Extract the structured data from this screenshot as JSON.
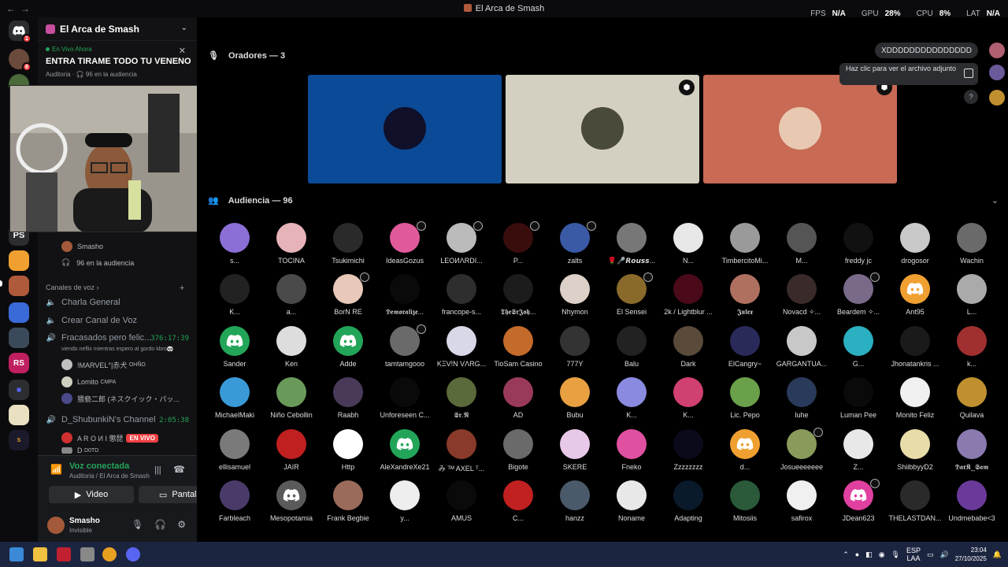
{
  "window": {
    "title": "El Arca de Smash",
    "nav_back": "←",
    "nav_fwd": "→"
  },
  "stats": {
    "fps_label": "FPS",
    "fps": "N/A",
    "gpu_label": "GPU",
    "gpu": "28%",
    "cpu_label": "CPU",
    "cpu": "8%",
    "lat_label": "LAT",
    "lat": "N/A"
  },
  "server": {
    "name": "El Arca de Smash"
  },
  "live_now": {
    "label": "En Vivo Ahora",
    "stage_name": "ENTRA TIRAME TODO TU VENENO",
    "category": "Auditoria",
    "audience": "96 en la audiencia"
  },
  "stage_channel": {
    "user": "Smasho",
    "audience": "96 en la audiencia"
  },
  "voice_section": {
    "label": "Canales de voz",
    "add": "+"
  },
  "channels": [
    {
      "name": "Charla General"
    },
    {
      "name": "Crear Canal de Voz"
    },
    {
      "name": "Fracasados pero felic...",
      "time": "376:17:39",
      "status": "viendo neflix mientras espero al gordo kbro🐼",
      "users": [
        {
          "name": "!MARVEL°|赤犬",
          "tag": "OHÑO"
        },
        {
          "name": "Lomito",
          "tag": "CMPA"
        },
        {
          "name": "猥褻二郎 (ネスクイック・パッ..."
        }
      ]
    },
    {
      "name": "D_ShubunkiN's Channel",
      "time": "2:05:38",
      "users": [
        {
          "name": "A R O И I 懲琵",
          "live": "EN VIVO"
        },
        {
          "name": "D",
          "tag": "D0TD"
        }
      ]
    }
  ],
  "voice_panel": {
    "status": "Voz conectada",
    "location": "Auditoria / El Arca de Smash",
    "video": "Video",
    "screen": "Pantalla"
  },
  "user": {
    "name": "Smasho",
    "status": "Invisible"
  },
  "speakers": {
    "header": "Oradores — 3",
    "tiles": [
      {
        "bg": "#0b4a96",
        "mod": false
      },
      {
        "bg": "#d4d0c1",
        "mod": true
      },
      {
        "bg": "#c86a54",
        "mod": true
      }
    ]
  },
  "audience": {
    "header": "Audiencia — 96"
  },
  "chat": {
    "bubble": "XDDDDDDDDDDDDDDD",
    "attachment": "Haz clic para ver el archivo adjunto",
    "help": "?"
  },
  "members": [
    [
      "s...",
      "TOCINA",
      "Tsukimichi",
      "IdeasGozus",
      "LEOИΛRDI...",
      "P...",
      "zalts",
      "🌹🎤𝙍𝙤𝙪𝙨𝙨...",
      "N...",
      "TimbercitoMi...",
      "M...",
      "freddy jc",
      "drogosor",
      "Wachin"
    ],
    [
      "K...",
      "a...",
      "BorN RE",
      "𝕯𝖊𝖒𝖔𝖗𝖆𝖑𝖎𝖟𝖊...",
      "francope-s...",
      "𝕿𝖍𝖊𝕾𝖗𝕵𝖔𝖍...",
      "Nhymon",
      "El Sensei",
      "2k / Lightblur ...",
      "𝕵𝖚𝖑𝖊𝖝",
      "Novacd ✧...",
      "Beardem ✧...",
      "Ant95",
      "L..."
    ],
    [
      "Sander",
      "Ken",
      "Adde",
      "tamtamgooo",
      "KΞV!N VΛRG...",
      "TioSam Casino",
      "777Y",
      "Balu",
      "Dark",
      "ElCangry~",
      "GARGANTUA...",
      "G...",
      "Jhonatankris ...",
      "k..."
    ],
    [
      "MichaelMaki",
      "Niño Cebollin",
      "Raabh",
      "Unforeseen C...",
      "𝕾𝖗.𝕹",
      "AD",
      "Bubu",
      "K...",
      "K...",
      "Lic. Pepo",
      "luhe",
      "Luman Pee",
      "Monito Feliz",
      "Quilava"
    ],
    [
      "ellisamuel",
      "JAIR",
      "Http",
      "AleXandreXe21",
      "み ᵀᴹ AXEL ᵀ...",
      "Bigote",
      "SKERE",
      "Fneko",
      "Zzzzzzzz",
      "d...",
      "Josueeeeeee",
      "Z...",
      "ShiibbyyD2",
      "𝕯𝖆𝖗𝕶_𝕾𝖆𝖒"
    ],
    [
      "Farbleach",
      "Mesopotamia",
      "Frank Begbie",
      "y...",
      "AMUS",
      "C...",
      "hanzz",
      "Noname",
      "Adapting",
      "Mitosiis",
      "safirox",
      "JDean623",
      "THELASTDAN...",
      "Undmebabe<3"
    ]
  ],
  "avatar_colors": [
    [
      "#8b6fd6",
      "#e6b3b8",
      "#2a2a2a",
      "#e05a9a",
      "#bbbbbb",
      "#3a0d0d",
      "#3a5aa6",
      "#777777",
      "#e8e8e8",
      "#9a9a9a",
      "#555555",
      "#111111",
      "#c9c9c9",
      "#6a6a6a"
    ],
    [
      "#222222",
      "#4a4a4a",
      "#e8c8b8",
      "#0a0a0a",
      "#2e2e2e",
      "#1c1c1c",
      "#ddd0c8",
      "#8a6a2a",
      "#4a0a1a",
      "#b07060",
      "#3a2a2a",
      "#7a6a8a",
      "#f0a030",
      "#aaaaaa"
    ],
    [
      "#23a559",
      "#dddddd",
      "#23a559",
      "#6a6a6a",
      "#d8d8e8",
      "#c46a2a",
      "#333333",
      "#222222",
      "#5a4a3a",
      "#2a2a5a",
      "#c8c8c8",
      "#2ab0c0",
      "#1a1a1a",
      "#a03030"
    ],
    [
      "#3a9ad8",
      "#6a9a5a",
      "#4a3a5a",
      "#0a0a0a",
      "#5a6a3a",
      "#9a3a5a",
      "#e8a040",
      "#8a8ae0",
      "#d04070",
      "#6aa04a",
      "#2a3a5a",
      "#0a0a0a",
      "#f0f0f0",
      "#c09030"
    ],
    [
      "#7a7a7a",
      "#c02020",
      "#ffffff",
      "#23a559",
      "#8a3a2a",
      "#6a6a6a",
      "#e8c8e8",
      "#e050a0",
      "#0a0a1a",
      "#f0a030",
      "#8a9a5a",
      "#e8e8e8",
      "#e8dca8",
      "#8a7ab0"
    ],
    [
      "#4a3a6a",
      "#5a5a5a",
      "#9a6a5a",
      "#eeeeee",
      "#0a0a0a",
      "#c02020",
      "#4a5a6a",
      "#e8e8e8",
      "#0a1a2a",
      "#2a5a3a",
      "#f0f0f0",
      "#e040a0",
      "#2a2a2a",
      "#6a3a9a"
    ]
  ],
  "discord_slots": [
    "2-0",
    "2-2",
    "4-3",
    "5-1",
    "1-12",
    "4-9",
    "5-11"
  ],
  "mod_slots": [
    "0-3",
    "0-4",
    "0-5",
    "0-6",
    "1-2",
    "1-7",
    "1-11",
    "2-3",
    "4-10",
    "5-11"
  ],
  "taskbar": {
    "lang1": "ESP",
    "lang2": "LAA",
    "time": "23:04",
    "date": "27/10/2025"
  }
}
